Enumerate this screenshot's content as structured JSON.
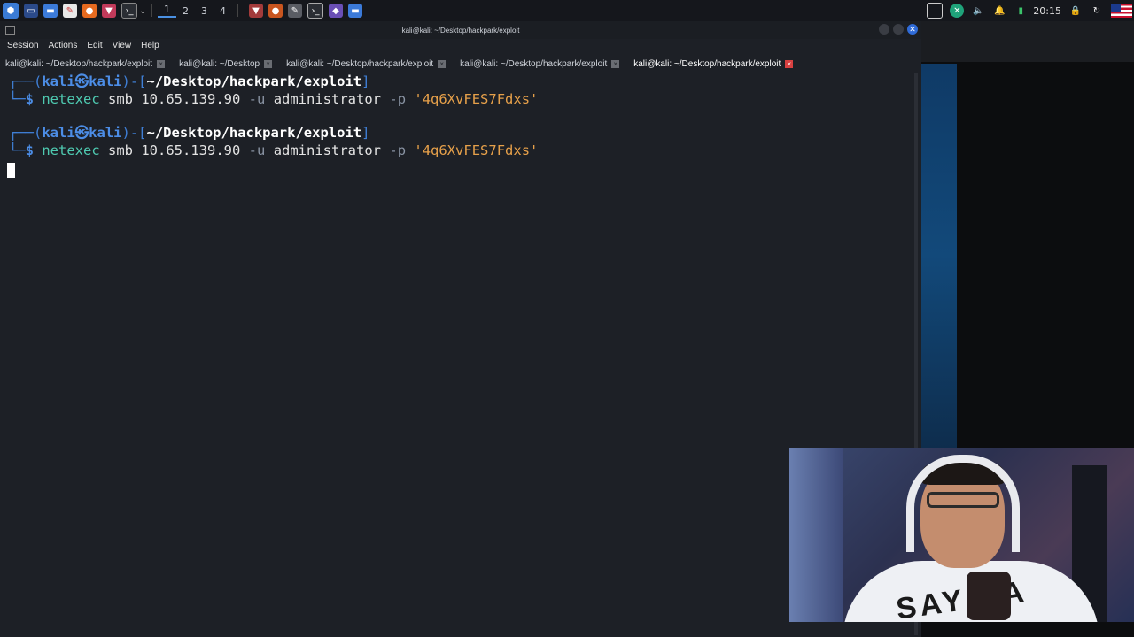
{
  "panel": {
    "workspaces": [
      "1",
      "2",
      "3",
      "4"
    ],
    "active_workspace": 0,
    "clock": "20:15",
    "accent": "#4a90e2"
  },
  "window": {
    "title": "kali@kali: ~/Desktop/hackpark/exploit",
    "menu": [
      "Session",
      "Actions",
      "Edit",
      "View",
      "Help"
    ],
    "tabs": [
      {
        "label": "kali@kali: ~/Desktop/hackpark/exploit",
        "active": false
      },
      {
        "label": "kali@kali: ~/Desktop",
        "active": false
      },
      {
        "label": "kali@kali: ~/Desktop/hackpark/exploit",
        "active": false
      },
      {
        "label": "kali@kali: ~/Desktop/hackpark/exploit",
        "active": false
      },
      {
        "label": "kali@kali: ~/Desktop/hackpark/exploit",
        "active": true
      }
    ]
  },
  "terminal": {
    "lines": [
      {
        "user": "kali",
        "at_symbol": "㉿",
        "host": "kali",
        "path": "~/Desktop/hackpark/exploit",
        "command": "netexec",
        "args1": "smb 10.65.139.90",
        "flag1": "-u",
        "args2": "administrator",
        "flag2": "-p",
        "password": "'4q6XvFES7Fdxs'"
      },
      {
        "user": "kali",
        "at_symbol": "㉿",
        "host": "kali",
        "path": "~/Desktop/hackpark/exploit",
        "command": "netexec",
        "args1": "smb 10.65.139.90",
        "flag1": "-u",
        "args2": "administrator",
        "flag2": "-p",
        "password": "'4q6XvFES7Fdxs'"
      }
    ],
    "colors": {
      "prompt": "#4c8de6",
      "command": "#4ec9b0",
      "string": "#e6a04a",
      "background": "#1d2026"
    }
  },
  "webcam": {
    "shirt_text": "SAY NA"
  }
}
